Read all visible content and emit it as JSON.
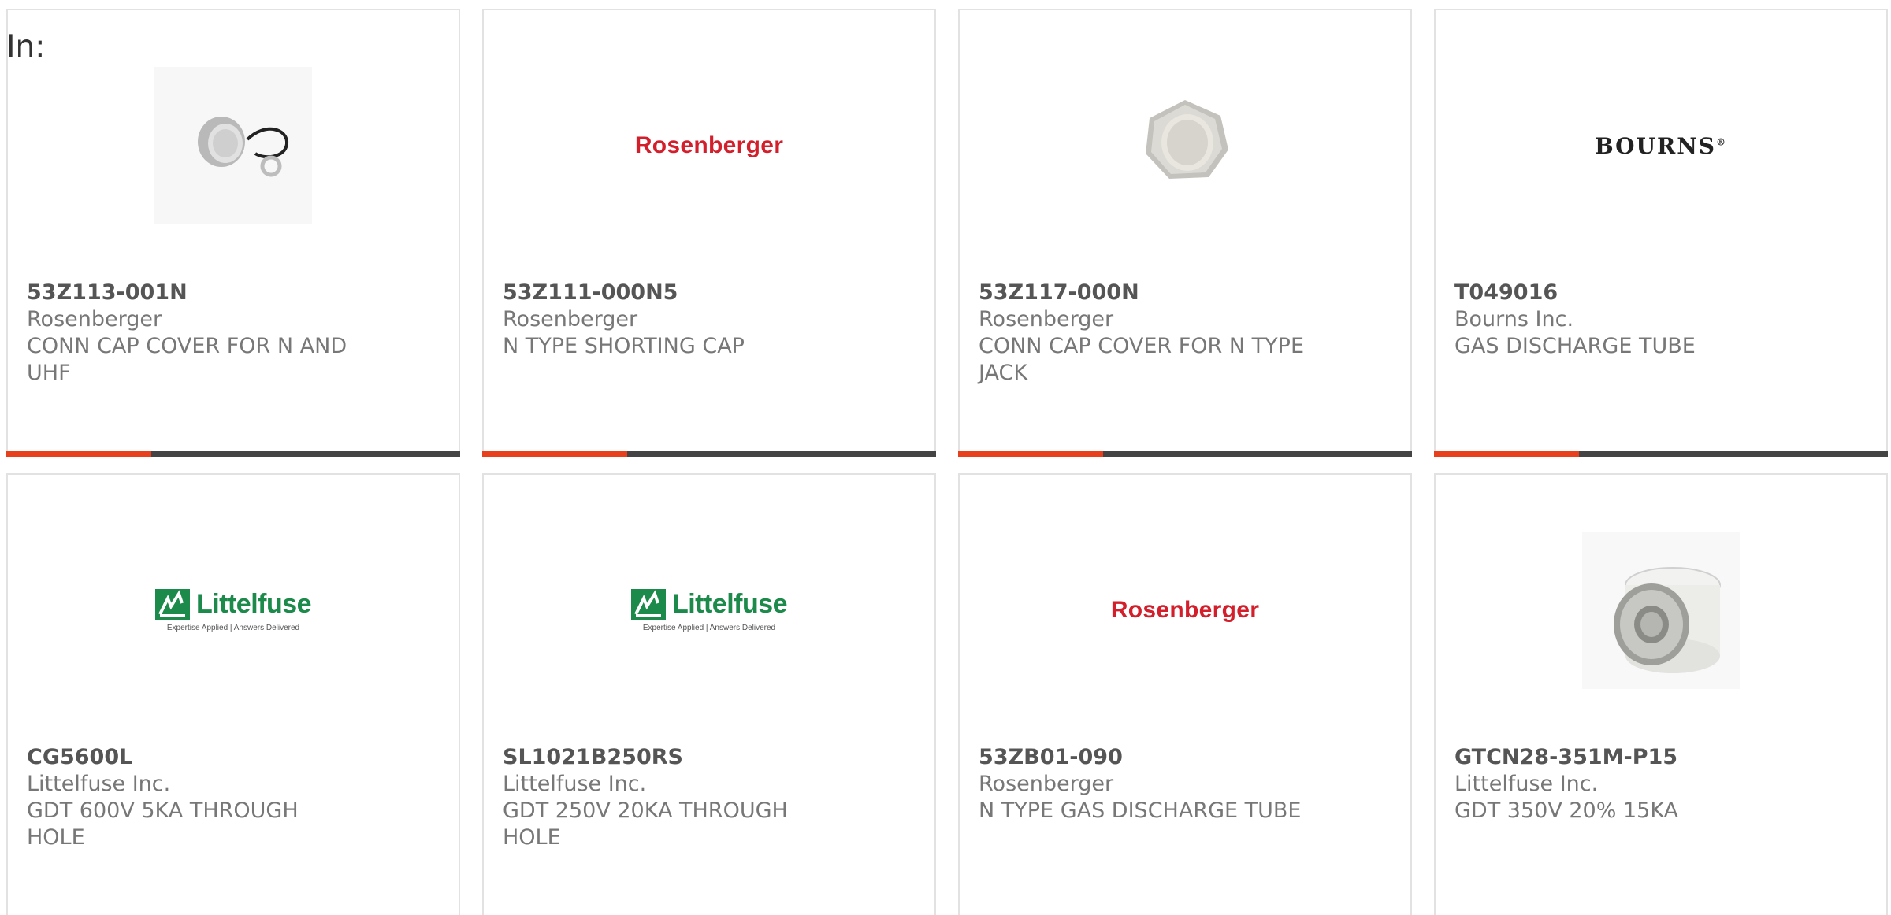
{
  "header": {
    "in_label": "In:"
  },
  "colors": {
    "accent": "#e8401c",
    "bar": "#444444",
    "rosenberger_red": "#d21f2b",
    "littelfuse_green": "#1b8a4a"
  },
  "products": [
    {
      "part": "53Z113-001N",
      "manufacturer": "Rosenberger",
      "description": "CONN CAP COVER FOR N AND UHF",
      "image": "cap-with-lanyard-photo"
    },
    {
      "part": "53Z111-000N5",
      "manufacturer": "Rosenberger",
      "description": "N TYPE SHORTING CAP",
      "image": "rosenberger-logo",
      "logo_text": "Rosenberger"
    },
    {
      "part": "53Z117-000N",
      "manufacturer": "Rosenberger",
      "description": "CONN CAP COVER FOR N TYPE JACK",
      "image": "hex-cap-photo"
    },
    {
      "part": "T049016",
      "manufacturer": "Bourns Inc.",
      "description": "GAS DISCHARGE TUBE",
      "image": "bourns-logo",
      "logo_text": "BOURNS"
    },
    {
      "part": "CG5600L",
      "manufacturer": "Littelfuse Inc.",
      "description": "GDT 600V 5KA THROUGH HOLE",
      "image": "littelfuse-logo",
      "logo_text": "Littelfuse",
      "logo_tagline": "Expertise Applied | Answers Delivered"
    },
    {
      "part": "SL1021B250RS",
      "manufacturer": "Littelfuse Inc.",
      "description": "GDT 250V 20KA THROUGH HOLE",
      "image": "littelfuse-logo",
      "logo_text": "Littelfuse",
      "logo_tagline": "Expertise Applied | Answers Delivered"
    },
    {
      "part": "53ZB01-090",
      "manufacturer": "Rosenberger",
      "description": "N TYPE GAS DISCHARGE TUBE",
      "image": "rosenberger-logo",
      "logo_text": "Rosenberger"
    },
    {
      "part": "GTCN28-351M-P15",
      "manufacturer": "Littelfuse Inc.",
      "description": "GDT 350V 20% 15KA",
      "image": "gas-discharge-tube-photo"
    }
  ]
}
